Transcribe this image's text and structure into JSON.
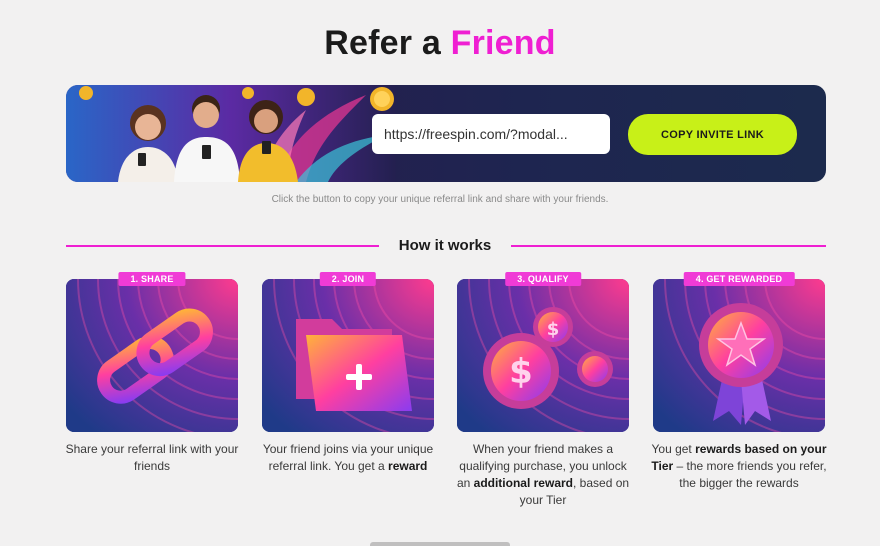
{
  "title": {
    "prefix": "Refer a",
    "accent": "Friend"
  },
  "invite": {
    "link_value": "https://freespin.com/?modal...",
    "copy_label": "COPY INVITE LINK",
    "hint": "Click the button to copy your unique referral link and share with your friends."
  },
  "section_title": "How it works",
  "steps": [
    {
      "badge": "1. SHARE",
      "icon": "chain-link-icon",
      "text": "Share your referral link with your friends"
    },
    {
      "badge": "2. JOIN",
      "icon": "folder-plus-icon",
      "text_a": "Your friend joins via your unique referral link. You get a ",
      "text_b": "reward"
    },
    {
      "badge": "3. QUALIFY",
      "icon": "coins-icon",
      "text_a": "When your friend makes a qualifying purchase, you unlock an ",
      "text_b": "additional reward",
      "text_c": ", based on your Tier"
    },
    {
      "badge": "4. GET REWARDED",
      "icon": "medal-icon",
      "text_a": "You get ",
      "text_b": "rewards based on your Tier",
      "text_c": " – the more friends you refer, the bigger the rewards"
    }
  ],
  "colors": {
    "accent": "#ef1fd2",
    "button": "#c8f018",
    "card_bg": "#233a86"
  }
}
